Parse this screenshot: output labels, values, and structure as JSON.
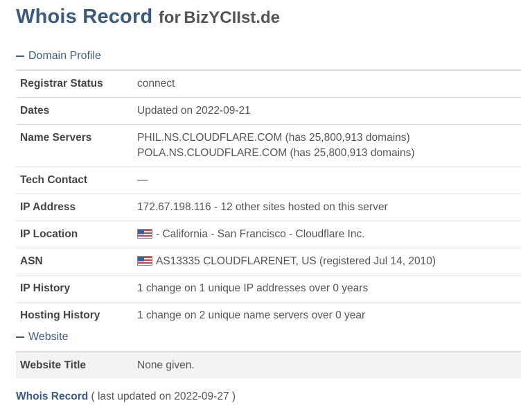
{
  "title": {
    "main": "Whois Record",
    "for": "for",
    "domain": "BizYCIIst.de"
  },
  "sections": {
    "domain_profile": "Domain Profile",
    "website": "Website"
  },
  "profile": {
    "registrar_status": {
      "label": "Registrar Status",
      "value": "connect"
    },
    "dates": {
      "label": "Dates",
      "value": "Updated on 2022-09-21"
    },
    "name_servers": {
      "label": "Name Servers",
      "values": [
        "PHIL.NS.CLOUDFLARE.COM (has 25,800,913 domains)",
        "POLA.NS.CLOUDFLARE.COM (has 25,800,913 domains)"
      ]
    },
    "tech_contact": {
      "label": "Tech Contact",
      "value": "—"
    },
    "ip_address": {
      "label": "IP Address",
      "value": "172.67.198.116 - 12 other sites hosted on this server"
    },
    "ip_location": {
      "label": "IP Location",
      "value": "- California - San Francisco - Cloudflare Inc.",
      "icon": "us-flag-icon"
    },
    "asn": {
      "label": "ASN",
      "value": "AS13335 CLOUDFLARENET, US (registered Jul 14, 2010)",
      "icon": "us-flag-icon"
    },
    "ip_history": {
      "label": "IP History",
      "value": "1 change on 1 unique IP addresses over 0 years"
    },
    "hosting_history": {
      "label": "Hosting History",
      "value": "1 change on 2 unique name servers over 0 year"
    }
  },
  "website": {
    "title": {
      "label": "Website Title",
      "value": "None given."
    }
  },
  "footer": {
    "link": "Whois Record",
    "note": "( last updated on 2022-09-27 )"
  },
  "colors": {
    "accent": "#3a5a80",
    "text": "#555555",
    "row_shade": "#f2f2f2"
  }
}
